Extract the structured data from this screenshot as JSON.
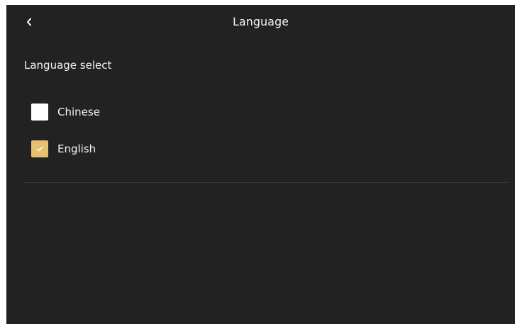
{
  "header": {
    "title": "Language",
    "back_icon": "chevron-left-icon"
  },
  "section": {
    "label": "Language select"
  },
  "options": [
    {
      "label": "Chinese",
      "checked": false
    },
    {
      "label": "English",
      "checked": true
    }
  ],
  "colors": {
    "background": "#222222",
    "accent": "#e7c171",
    "checkbox_unchecked": "#ffffff",
    "text": "#f2f2f2",
    "divider": "#3a3a3a"
  }
}
